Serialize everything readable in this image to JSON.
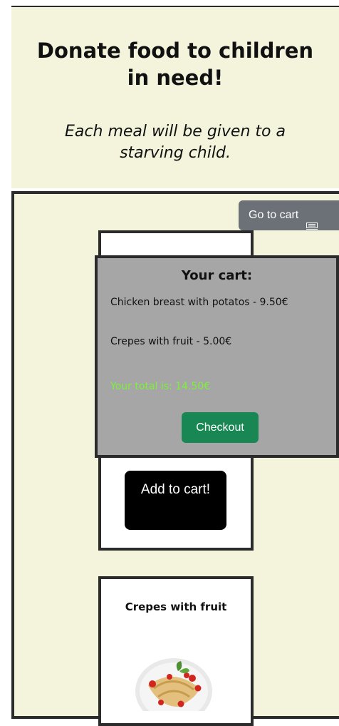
{
  "header": {
    "title": "Donate food to children in need!",
    "subtitle": "Each meal will be given to a starving child."
  },
  "toolbar": {
    "cart_button_label": "Go to cart",
    "cart_icon": "cart-icon"
  },
  "products": [
    {
      "name": "",
      "add_button_label": "Add to cart!"
    },
    {
      "name": "Crepes with fruit",
      "image_icon": "crepes-plate-image"
    }
  ],
  "cart": {
    "heading": "Your cart:",
    "items": [
      {
        "label": "Chicken breast with potatos - 9.50€"
      },
      {
        "label": "Crepes with fruit - 5.00€"
      }
    ],
    "total_label": "Your total is: 14.50€",
    "checkout_label": "Checkout"
  },
  "colors": {
    "page_bg": "#f4f4dc",
    "border": "#2b2b2b",
    "cart_popover_bg": "#a6a6a6",
    "cart_button_bg": "#6b7177",
    "checkout_bg": "#198754",
    "total_text": "#7cf03d",
    "add_button_bg": "#000000"
  }
}
